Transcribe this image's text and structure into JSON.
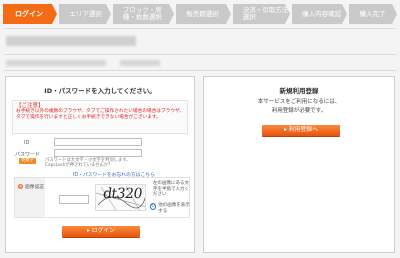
{
  "steps": [
    {
      "label": "ログイン",
      "active": true
    },
    {
      "label": "エリア選択"
    },
    {
      "label": "ブロック・席種・枚数選択"
    },
    {
      "label": "販売期選択"
    },
    {
      "label": "決済・引取方法選択"
    },
    {
      "label": "購入内容確認"
    },
    {
      "label": "購入完了"
    }
  ],
  "login": {
    "title": "ID・パスワードを入力してください。",
    "warning_heading": "【ご注意】",
    "warning_body": "お手続き以外の複数のブラウザ、タブでご操作されたい場合の場合はブラウザ、タブで操作を行いますと正しくお手続きできない場合がございます。",
    "id_label": "ID",
    "password_label": "パスワード",
    "badge": "英数字",
    "password_note_1": "パスワードは大文字・小文字を判別します。",
    "password_note_2": "CapsLockが押されていませんか？",
    "forgot_link": "ID・パスワードをお忘れの方はこちら",
    "captcha_label": "画像認証",
    "captcha_badge": "※",
    "captcha_text": "dt320",
    "captcha_note": "左の画像にある文字を半角で入力ください",
    "reload_icon": "↻",
    "reload_text": "他の画像を表示する",
    "login_button": "▸ ログイン"
  },
  "register": {
    "title": "新規利用登録",
    "line1": "本サービスをご利用になるには、",
    "line2": "利用登録が必要です。",
    "button": "▸ 利用登録へ"
  }
}
